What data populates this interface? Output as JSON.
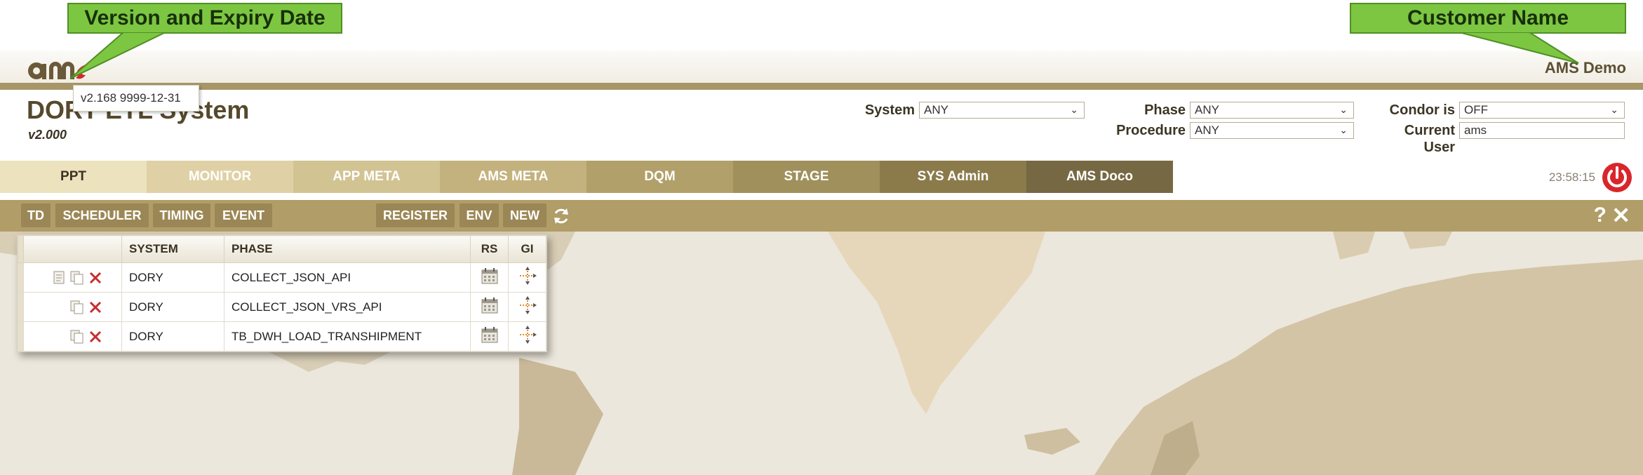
{
  "annotations": {
    "version_callout": "Version and Expiry Date",
    "customer_callout": "Customer Name"
  },
  "header": {
    "customer_name": "AMS Demo",
    "version_tooltip": "v2.168 9999-12-31",
    "app_title": "DORY ETL System",
    "app_version": "v2.000"
  },
  "filters": {
    "system_label": "System",
    "system_value": "ANY",
    "phase_label": "Phase",
    "phase_value": "ANY",
    "procedure_label": "Procedure",
    "procedure_value": "ANY",
    "condor_label": "Condor is",
    "condor_value": "OFF",
    "current_user_label_1": "Current",
    "current_user_label_2": "User",
    "current_user_value": "ams"
  },
  "tabs": [
    {
      "label": "PPT",
      "color": "#ece2bd",
      "text": "#3a3222"
    },
    {
      "label": "MONITOR",
      "color": "#dfd1a5",
      "text": "#ffffff"
    },
    {
      "label": "APP META",
      "color": "#d2c393",
      "text": "#ffffff"
    },
    {
      "label": "AMS META",
      "color": "#c4b27e",
      "text": "#ffffff"
    },
    {
      "label": "DQM",
      "color": "#b2a06a",
      "text": "#ffffff"
    },
    {
      "label": "STAGE",
      "color": "#a0905c",
      "text": "#ffffff"
    },
    {
      "label": "SYS Admin",
      "color": "#8b7b4b",
      "text": "#ffffff"
    },
    {
      "label": "AMS Doco",
      "color": "#766842",
      "text": "#ffffff"
    }
  ],
  "clock": "23:58:15",
  "toolbar": {
    "td": "TD",
    "scheduler": "SCHEDULER",
    "timing": "TIMING",
    "event": "EVENT",
    "register": "REGISTER",
    "env": "ENV",
    "new": "NEW",
    "help": "?",
    "close": "✕"
  },
  "grid": {
    "headers": {
      "system": "SYSTEM",
      "phase": "PHASE",
      "rs": "RS",
      "gi": "GI"
    },
    "rows": [
      {
        "system": "DORY",
        "phase": "COLLECT_JSON_API",
        "has_doc": true
      },
      {
        "system": "DORY",
        "phase": "COLLECT_JSON_VRS_API",
        "has_doc": false
      },
      {
        "system": "DORY",
        "phase": "TB_DWH_LOAD_TRANSHIPMENT",
        "has_doc": false
      }
    ]
  },
  "colors": {
    "accent_gold": "#a69668",
    "toolbar": "#b09d67",
    "callout_green": "#7dc642",
    "power_red": "#d9262b",
    "delete_red": "#c62d2d"
  }
}
